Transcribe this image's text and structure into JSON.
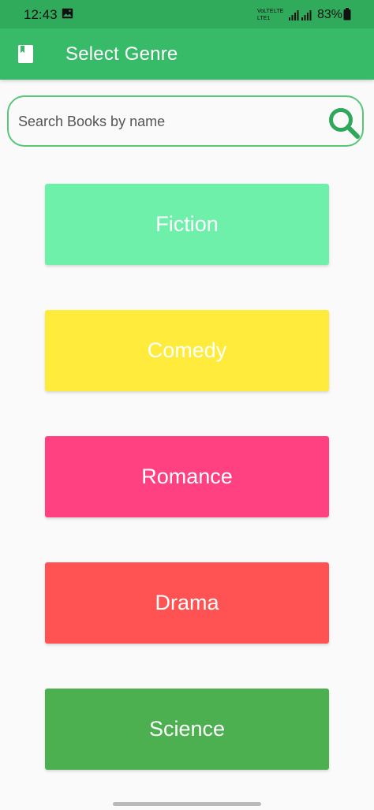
{
  "status_bar": {
    "time": "12:43",
    "network_top": "VoLTE",
    "network_bottom": "LTE1",
    "lte_label": "LTE",
    "battery": "83%",
    "icons": [
      "gallery-icon",
      "signal-icon",
      "battery-icon"
    ],
    "background": "#2fab5b"
  },
  "app_bar": {
    "title": "Select Genre",
    "icon": "book-icon",
    "background": "#37bb69"
  },
  "search": {
    "placeholder": "Search Books by name",
    "value": "",
    "icon": "search-icon",
    "border_color": "#57c777",
    "icon_color": "#2fa85c"
  },
  "genres": [
    {
      "label": "Fiction",
      "color": "#6ef0ab"
    },
    {
      "label": "Comedy",
      "color": "#ffeb3b"
    },
    {
      "label": "Romance",
      "color": "#ff4081"
    },
    {
      "label": "Drama",
      "color": "#ff5252"
    },
    {
      "label": "Science",
      "color": "#4caf50"
    }
  ]
}
